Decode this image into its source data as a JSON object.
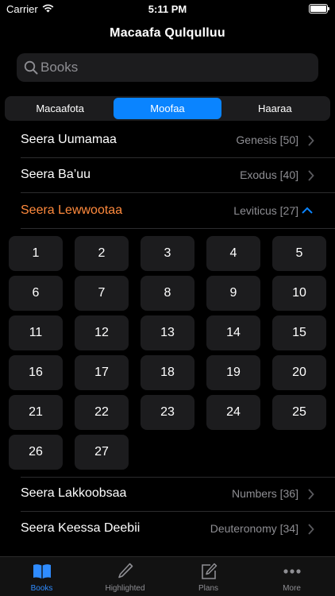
{
  "status": {
    "carrier": "Carrier",
    "time": "5:11 PM"
  },
  "nav": {
    "title": "Macaafa Qulqulluu"
  },
  "search": {
    "placeholder": "Books"
  },
  "segments": [
    {
      "label": "Macaafota",
      "active": false
    },
    {
      "label": "Moofaa",
      "active": true
    },
    {
      "label": "Haaraa",
      "active": false
    }
  ],
  "books_top": [
    {
      "name": "Seera Uumamaa",
      "meta": "Genesis [50]"
    },
    {
      "name": "Seera Ba’uu",
      "meta": "Exodus [40]"
    }
  ],
  "expanded_book": {
    "name": "Seera Lewwootaa",
    "meta": "Leviticus [27]"
  },
  "chapters": [
    "1",
    "2",
    "3",
    "4",
    "5",
    "6",
    "7",
    "8",
    "9",
    "10",
    "11",
    "12",
    "13",
    "14",
    "15",
    "16",
    "17",
    "18",
    "19",
    "20",
    "21",
    "22",
    "23",
    "24",
    "25",
    "26",
    "27"
  ],
  "books_bottom": [
    {
      "name": "Seera Lakkoobsaa",
      "meta": "Numbers [36]"
    },
    {
      "name": "Seera Keessa Deebii",
      "meta": "Deuteronomy [34]"
    }
  ],
  "tabs": [
    {
      "label": "Books",
      "active": true,
      "icon": "book-icon"
    },
    {
      "label": "Highlighted",
      "active": false,
      "icon": "pencil-icon"
    },
    {
      "label": "Plans",
      "active": false,
      "icon": "compose-icon"
    },
    {
      "label": "More",
      "active": false,
      "icon": "more-icon"
    }
  ],
  "colors": {
    "accent": "#0a84ff",
    "expanded": "#ff8a3d",
    "secondary_text": "#8e8e93",
    "cell_bg": "#1c1c1e"
  }
}
